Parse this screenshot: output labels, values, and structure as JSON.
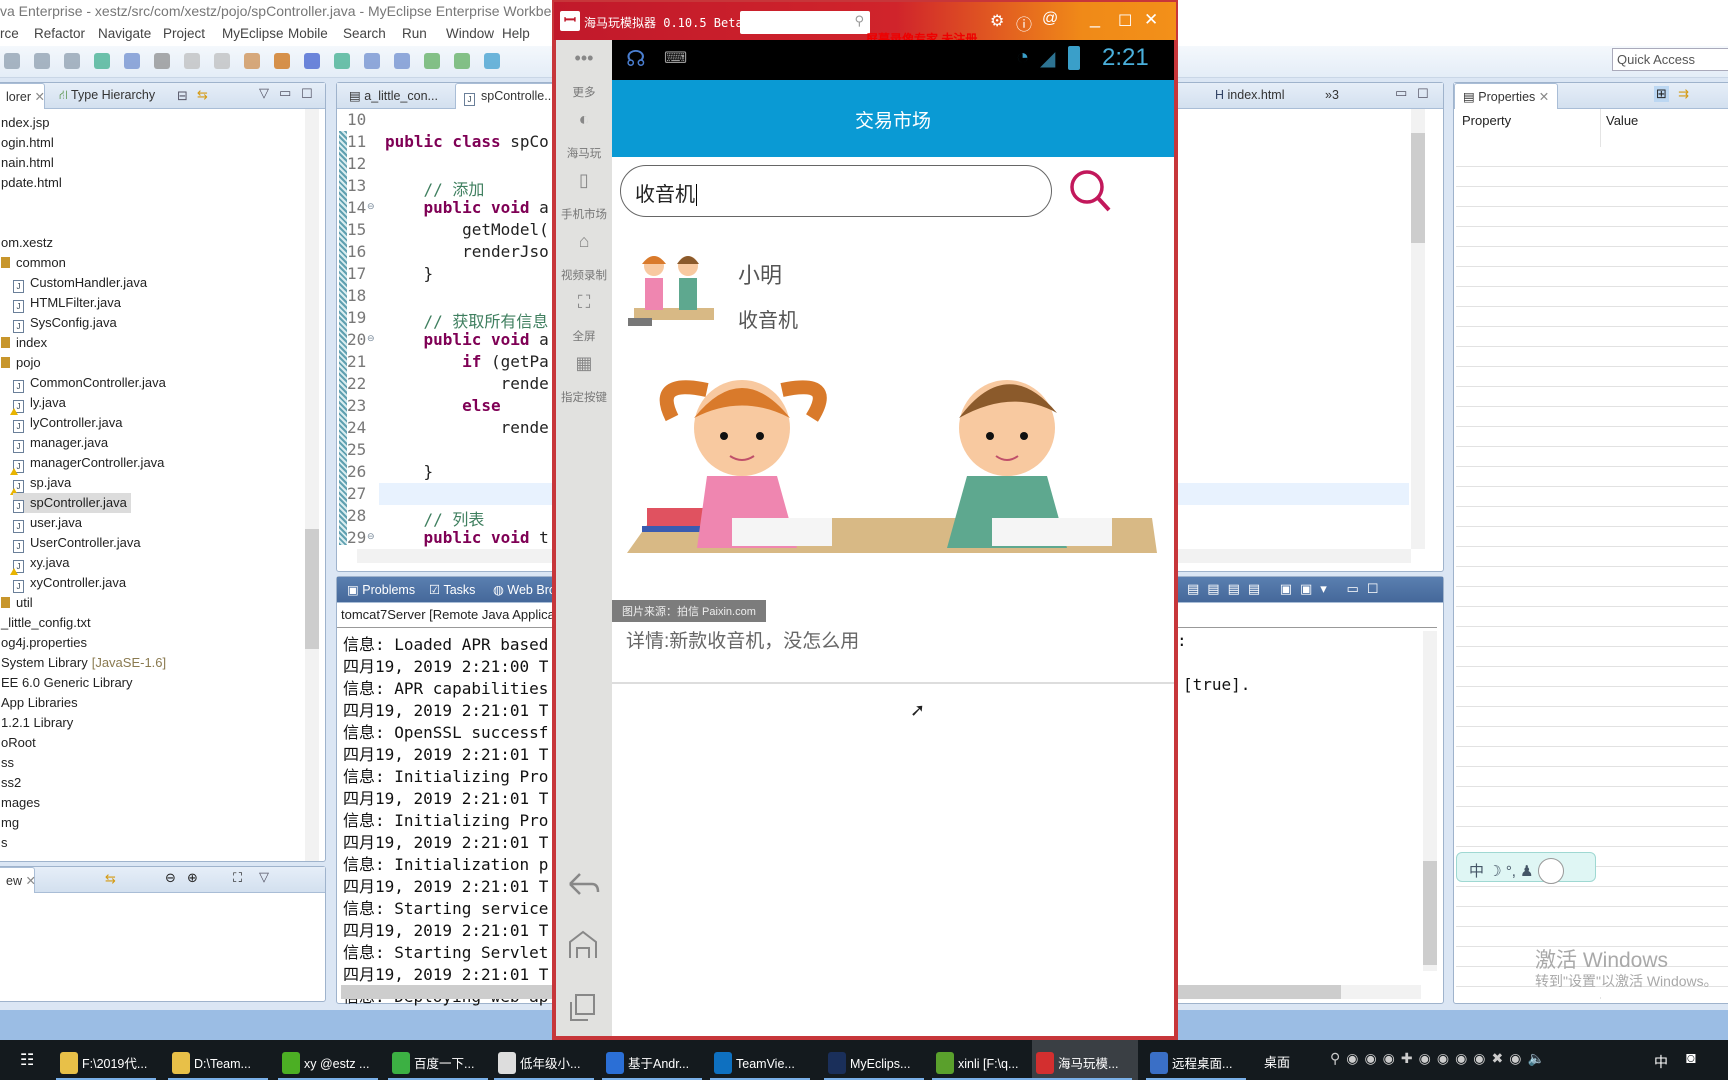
{
  "window": {
    "title": "va Enterprise - xestz/src/com/xestz/pojo/spController.java - MyEclipse Enterprise Workbench"
  },
  "menu": [
    "rce",
    "Refactor",
    "Navigate",
    "Project",
    "MyEclipse",
    "Mobile",
    "Search",
    "Run",
    "Window",
    "Help"
  ],
  "quick_access": {
    "placeholder": "Quick Access"
  },
  "explorer": {
    "tab_label": "lorer",
    "type_hierarchy_label": "Type Hierarchy",
    "items": [
      {
        "label": "ndex.jsp",
        "kind": "file",
        "indent": 0
      },
      {
        "label": "ogin.html",
        "kind": "file",
        "indent": 0
      },
      {
        "label": "nain.html",
        "kind": "file",
        "indent": 0
      },
      {
        "label": "pdate.html",
        "kind": "file",
        "indent": 0
      },
      {
        "label": "",
        "kind": "blank",
        "indent": 0
      },
      {
        "label": "",
        "kind": "blank",
        "indent": 0
      },
      {
        "label": "om.xestz",
        "kind": "file",
        "indent": 0
      },
      {
        "label": "common",
        "kind": "package",
        "indent": 0
      },
      {
        "label": "CustomHandler.java",
        "kind": "java",
        "indent": 1
      },
      {
        "label": "HTMLFilter.java",
        "kind": "java",
        "indent": 1
      },
      {
        "label": "SysConfig.java",
        "kind": "java",
        "indent": 1
      },
      {
        "label": "index",
        "kind": "package",
        "indent": 0
      },
      {
        "label": "pojo",
        "kind": "package",
        "indent": 0
      },
      {
        "label": "CommonController.java",
        "kind": "java",
        "indent": 1
      },
      {
        "label": "ly.java",
        "kind": "java-warn",
        "indent": 1
      },
      {
        "label": "lyController.java",
        "kind": "java",
        "indent": 1
      },
      {
        "label": "manager.java",
        "kind": "java",
        "indent": 1
      },
      {
        "label": "managerController.java",
        "kind": "java-warn",
        "indent": 1
      },
      {
        "label": "sp.java",
        "kind": "java-warn",
        "indent": 1
      },
      {
        "label": "spController.java",
        "kind": "java",
        "indent": 1,
        "selected": true
      },
      {
        "label": "user.java",
        "kind": "java",
        "indent": 1
      },
      {
        "label": "UserController.java",
        "kind": "java",
        "indent": 1
      },
      {
        "label": "xy.java",
        "kind": "java-warn",
        "indent": 1
      },
      {
        "label": "xyController.java",
        "kind": "java",
        "indent": 1
      },
      {
        "label": "util",
        "kind": "package",
        "indent": 0
      },
      {
        "label": "_little_config.txt",
        "kind": "file",
        "indent": 0
      },
      {
        "label": "og4j.properties",
        "kind": "file",
        "indent": 0
      },
      {
        "label": "System Library",
        "suffix": "[JavaSE-1.6]",
        "kind": "file",
        "indent": 0
      },
      {
        "label": "EE 6.0 Generic Library",
        "kind": "file",
        "indent": 0
      },
      {
        "label": "App Libraries",
        "kind": "file",
        "indent": 0
      },
      {
        "label": "1.2.1 Library",
        "kind": "file",
        "indent": 0
      },
      {
        "label": "oRoot",
        "kind": "file",
        "indent": 0
      },
      {
        "label": "ss",
        "kind": "file",
        "indent": 0
      },
      {
        "label": "ss2",
        "kind": "file",
        "indent": 0
      },
      {
        "label": "mages",
        "kind": "file",
        "indent": 0
      },
      {
        "label": "mg",
        "kind": "file",
        "indent": 0
      },
      {
        "label": "s",
        "kind": "file",
        "indent": 0
      }
    ]
  },
  "outline": {
    "tab_label": "ew"
  },
  "editor": {
    "tabs": [
      {
        "label": "a_little_con..."
      },
      {
        "label": "spControlle..."
      },
      {
        "label": "index.html"
      },
      {
        "label": "»3"
      }
    ],
    "lines": [
      {
        "num": "10",
        "segs": []
      },
      {
        "num": "11",
        "segs": [
          {
            "t": "public class ",
            "k": "kw"
          },
          {
            "t": "spCo",
            "k": ""
          }
        ]
      },
      {
        "num": "12",
        "segs": []
      },
      {
        "num": "13",
        "segs": [
          {
            "t": "    // 添加",
            "k": "cm"
          }
        ]
      },
      {
        "num": "14",
        "fold": true,
        "segs": [
          {
            "t": "    public void ",
            "k": "kw"
          },
          {
            "t": "a",
            "k": ""
          }
        ]
      },
      {
        "num": "15",
        "segs": [
          {
            "t": "        getModel(",
            "k": ""
          }
        ]
      },
      {
        "num": "16",
        "segs": [
          {
            "t": "        renderJso",
            "k": ""
          }
        ]
      },
      {
        "num": "17",
        "segs": [
          {
            "t": "    }",
            "k": ""
          }
        ]
      },
      {
        "num": "18",
        "segs": []
      },
      {
        "num": "19",
        "segs": [
          {
            "t": "    // 获取所有信息",
            "k": "cm"
          }
        ]
      },
      {
        "num": "20",
        "fold": true,
        "segs": [
          {
            "t": "    public void ",
            "k": "kw"
          },
          {
            "t": "a",
            "k": ""
          }
        ]
      },
      {
        "num": "21",
        "segs": [
          {
            "t": "        if ",
            "k": "kw"
          },
          {
            "t": "(getPa",
            "k": ""
          }
        ]
      },
      {
        "num": "22",
        "segs": [
          {
            "t": "            rende",
            "k": ""
          }
        ]
      },
      {
        "num": "23",
        "segs": [
          {
            "t": "        else",
            "k": "kw"
          }
        ]
      },
      {
        "num": "24",
        "segs": [
          {
            "t": "            rende",
            "k": ""
          }
        ]
      },
      {
        "num": "25",
        "segs": []
      },
      {
        "num": "26",
        "segs": [
          {
            "t": "    }",
            "k": ""
          }
        ]
      },
      {
        "num": "27",
        "current": true,
        "segs": []
      },
      {
        "num": "28",
        "segs": [
          {
            "t": "    // 列表",
            "k": "cm"
          }
        ]
      },
      {
        "num": "29",
        "fold": true,
        "segs": [
          {
            "t": "    public void ",
            "k": "kw"
          },
          {
            "t": "t",
            "k": ""
          }
        ]
      }
    ]
  },
  "console": {
    "tabs": [
      {
        "label": "Problems"
      },
      {
        "label": "Tasks"
      },
      {
        "label": "Web Brow"
      }
    ],
    "header": "tomcat7Server [Remote Java Applica",
    "lines": [
      "信息: Loaded APR based",
      "四月19, 2019 2:21:00 T",
      "信息: APR capabilities",
      "四月19, 2019 2:21:01 T",
      "信息: OpenSSL successf",
      "四月19, 2019 2:21:01 T",
      "信息: Initializing Pro",
      "四月19, 2019 2:21:01 T",
      "信息: Initializing Pro",
      "四月19, 2019 2:21:01 T",
      "信息: Initialization p",
      "四月19, 2019 2:21:01 T",
      "信息: Starting service",
      "四月19, 2019 2:21:01 T",
      "信息: Starting Servlet",
      "四月19, 2019 2:21:01 T",
      "信息: Deploying web ap"
    ],
    "right_fragments": [
      ":",
      "",
      "[true]."
    ]
  },
  "properties": {
    "tab_label": "Properties",
    "col_property": "Property",
    "col_value": "Value"
  },
  "emulator": {
    "title": "海马玩模拟器 0.10.5 Beta",
    "watermark": "屏幕录像专家 未注册",
    "sidebar": [
      {
        "label": "更多",
        "icon": "more-icon"
      },
      {
        "label": "海马玩",
        "icon": "haima-logo-icon"
      },
      {
        "label": "手机市场",
        "icon": "phone-market-icon"
      },
      {
        "label": "视频录制",
        "icon": "video-record-icon"
      },
      {
        "label": "全屏",
        "icon": "fullscreen-icon"
      },
      {
        "label": "指定按键",
        "icon": "keymap-icon"
      }
    ],
    "status_time": "2:21",
    "app": {
      "header_title": "交易市场",
      "search_value": "收音机",
      "result": {
        "user": "小明",
        "item": "收音机"
      },
      "image_caption": "图片来源：拍信 Paixin.com",
      "detail": "详情:新款收音机，没怎么用"
    },
    "colors": {
      "header": "#0a9ad4",
      "search_icon": "#c2185b",
      "frame": "#c7363a"
    }
  },
  "ime": {
    "label": "中"
  },
  "activation": {
    "title": "激活 Windows",
    "subtitle": "转到\"设置\"以激活 Windows。"
  },
  "taskbar": {
    "items": [
      {
        "label": "F:\\2019代...",
        "color": "#e8c048"
      },
      {
        "label": "D:\\Team...",
        "color": "#e8c048"
      },
      {
        "label": "xy @estz ...",
        "color": "#4caf24"
      },
      {
        "label": "百度一下...",
        "color": "#3cb043"
      },
      {
        "label": "低年级小...",
        "color": "#ddd"
      },
      {
        "label": "基于Andr...",
        "color": "#2b6fd6"
      },
      {
        "label": "TeamVie...",
        "color": "#0e70c0"
      },
      {
        "label": "MyEclips...",
        "color": "#1a2f5a"
      },
      {
        "label": "xinli [F:\\q...",
        "color": "#5aa02c"
      },
      {
        "label": "海马玩模...",
        "color": "#d32f2f",
        "active": true
      },
      {
        "label": "远程桌面...",
        "color": "#3a6fc6"
      }
    ],
    "desktop_label": "桌面",
    "tray_lang": "中"
  }
}
